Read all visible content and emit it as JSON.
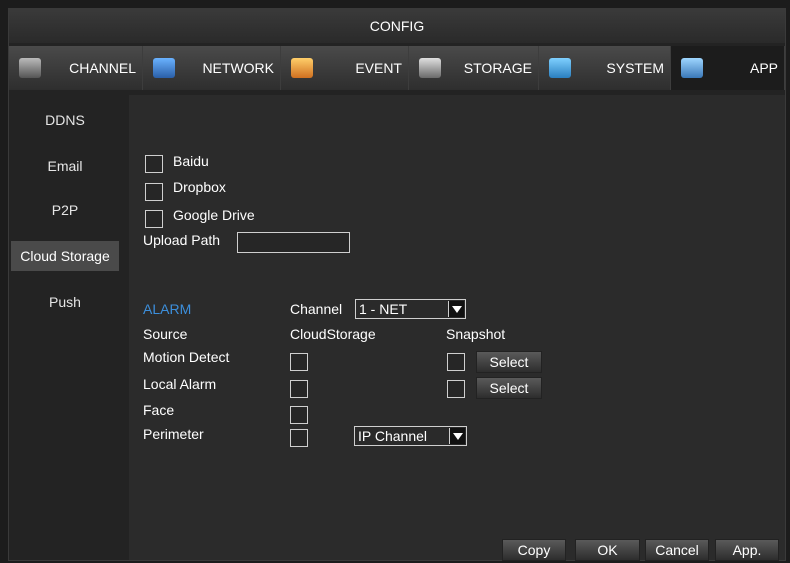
{
  "title": "CONFIG",
  "tabs": [
    {
      "label": "CHANNEL",
      "icon": "camera-icon"
    },
    {
      "label": "NETWORK",
      "icon": "network-icon"
    },
    {
      "label": "EVENT",
      "icon": "event-icon"
    },
    {
      "label": "STORAGE",
      "icon": "storage-icon"
    },
    {
      "label": "SYSTEM",
      "icon": "system-icon"
    },
    {
      "label": "APP",
      "icon": "app-icon"
    }
  ],
  "sidebar": {
    "items": [
      {
        "label": "DDNS"
      },
      {
        "label": "Email"
      },
      {
        "label": "P2P"
      },
      {
        "label": "Cloud Storage"
      },
      {
        "label": "Push"
      }
    ],
    "active": "Cloud Storage"
  },
  "cloud": {
    "baidu_label": "Baidu",
    "dropbox_label": "Dropbox",
    "google_label": "Google Drive",
    "upload_path_label": "Upload Path",
    "upload_path_value": ""
  },
  "alarm": {
    "heading": "ALARM",
    "channel_label": "Channel",
    "channel_value": "1 - NET",
    "source_header": "Source",
    "cloud_header": "CloudStorage",
    "snapshot_header": "Snapshot",
    "rows": [
      {
        "label": "Motion Detect",
        "select": "Select"
      },
      {
        "label": "Local Alarm",
        "select": "Select"
      },
      {
        "label": "Face"
      },
      {
        "label": "Perimeter",
        "dropdown": "IP Channel"
      }
    ]
  },
  "buttons": {
    "copy": "Copy",
    "ok": "OK",
    "cancel": "Cancel",
    "apply": "App."
  },
  "colors": {
    "accent": "#3c8fdc",
    "background": "#232323",
    "panel": "#2b2b2b"
  }
}
